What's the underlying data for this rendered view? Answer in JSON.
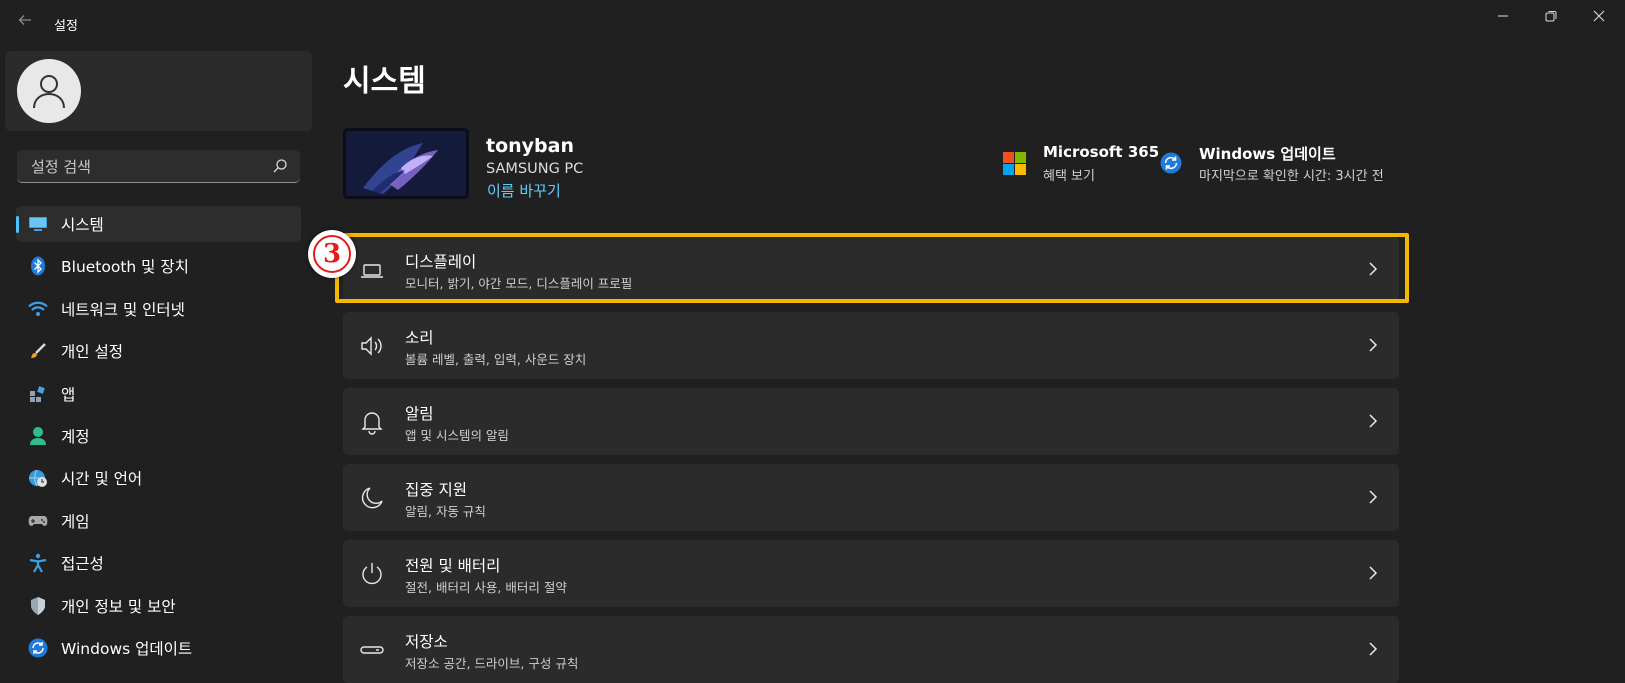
{
  "window": {
    "title": "설정",
    "controls": [
      "minimize",
      "restore",
      "close"
    ]
  },
  "sidebar": {
    "search_placeholder": "설정 검색",
    "items": [
      {
        "label": "시스템",
        "icon": "system-monitor-icon",
        "active": true
      },
      {
        "label": "Bluetooth 및 장치",
        "icon": "bluetooth-icon"
      },
      {
        "label": "네트워크 및 인터넷",
        "icon": "wifi-icon"
      },
      {
        "label": "개인 설정",
        "icon": "paintbrush-icon"
      },
      {
        "label": "앱",
        "icon": "apps-icon"
      },
      {
        "label": "계정",
        "icon": "account-icon"
      },
      {
        "label": "시간 및 언어",
        "icon": "globe-clock-icon"
      },
      {
        "label": "게임",
        "icon": "gamepad-icon"
      },
      {
        "label": "접근성",
        "icon": "accessibility-icon"
      },
      {
        "label": "개인 정보 및 보안",
        "icon": "shield-icon"
      },
      {
        "label": "Windows 업데이트",
        "icon": "windows-update-icon"
      }
    ]
  },
  "main": {
    "page_title": "시스템",
    "device": {
      "name": "tonyban",
      "model": "SAMSUNG PC",
      "rename_label": "이름 바꾸기"
    },
    "quick_links": [
      {
        "title": "Microsoft 365",
        "subtitle": "혜택 보기",
        "icon": "microsoft-logo-icon"
      },
      {
        "title": "Windows 업데이트",
        "subtitle": "마지막으로 확인한 시간: 3시간 전",
        "icon": "windows-update-icon"
      }
    ],
    "settings_cards": [
      {
        "title": "디스플레이",
        "subtitle": "모니터, 밝기, 야간 모드, 디스플레이 프로필",
        "icon": "laptop-display-icon"
      },
      {
        "title": "소리",
        "subtitle": "볼륨 레벨, 출력, 입력, 사운드 장치",
        "icon": "speaker-icon"
      },
      {
        "title": "알림",
        "subtitle": "앱 및 시스템의 알림",
        "icon": "bell-icon"
      },
      {
        "title": "집중 지원",
        "subtitle": "알림, 자동 규칙",
        "icon": "moon-icon"
      },
      {
        "title": "전원 및 배터리",
        "subtitle": "절전, 배터리 사용, 배터리 절약",
        "icon": "power-icon"
      },
      {
        "title": "저장소",
        "subtitle": "저장소 공간, 드라이브, 구성 규칙",
        "icon": "storage-drive-icon"
      }
    ]
  },
  "annotation": {
    "step_number": "3",
    "highlight_color": "#f5b800",
    "badge_color": "#e31b1b"
  },
  "colors": {
    "background": "#202020",
    "card": "#2b2b2b",
    "accent": "#4cc2ff",
    "link": "#60cdff"
  }
}
